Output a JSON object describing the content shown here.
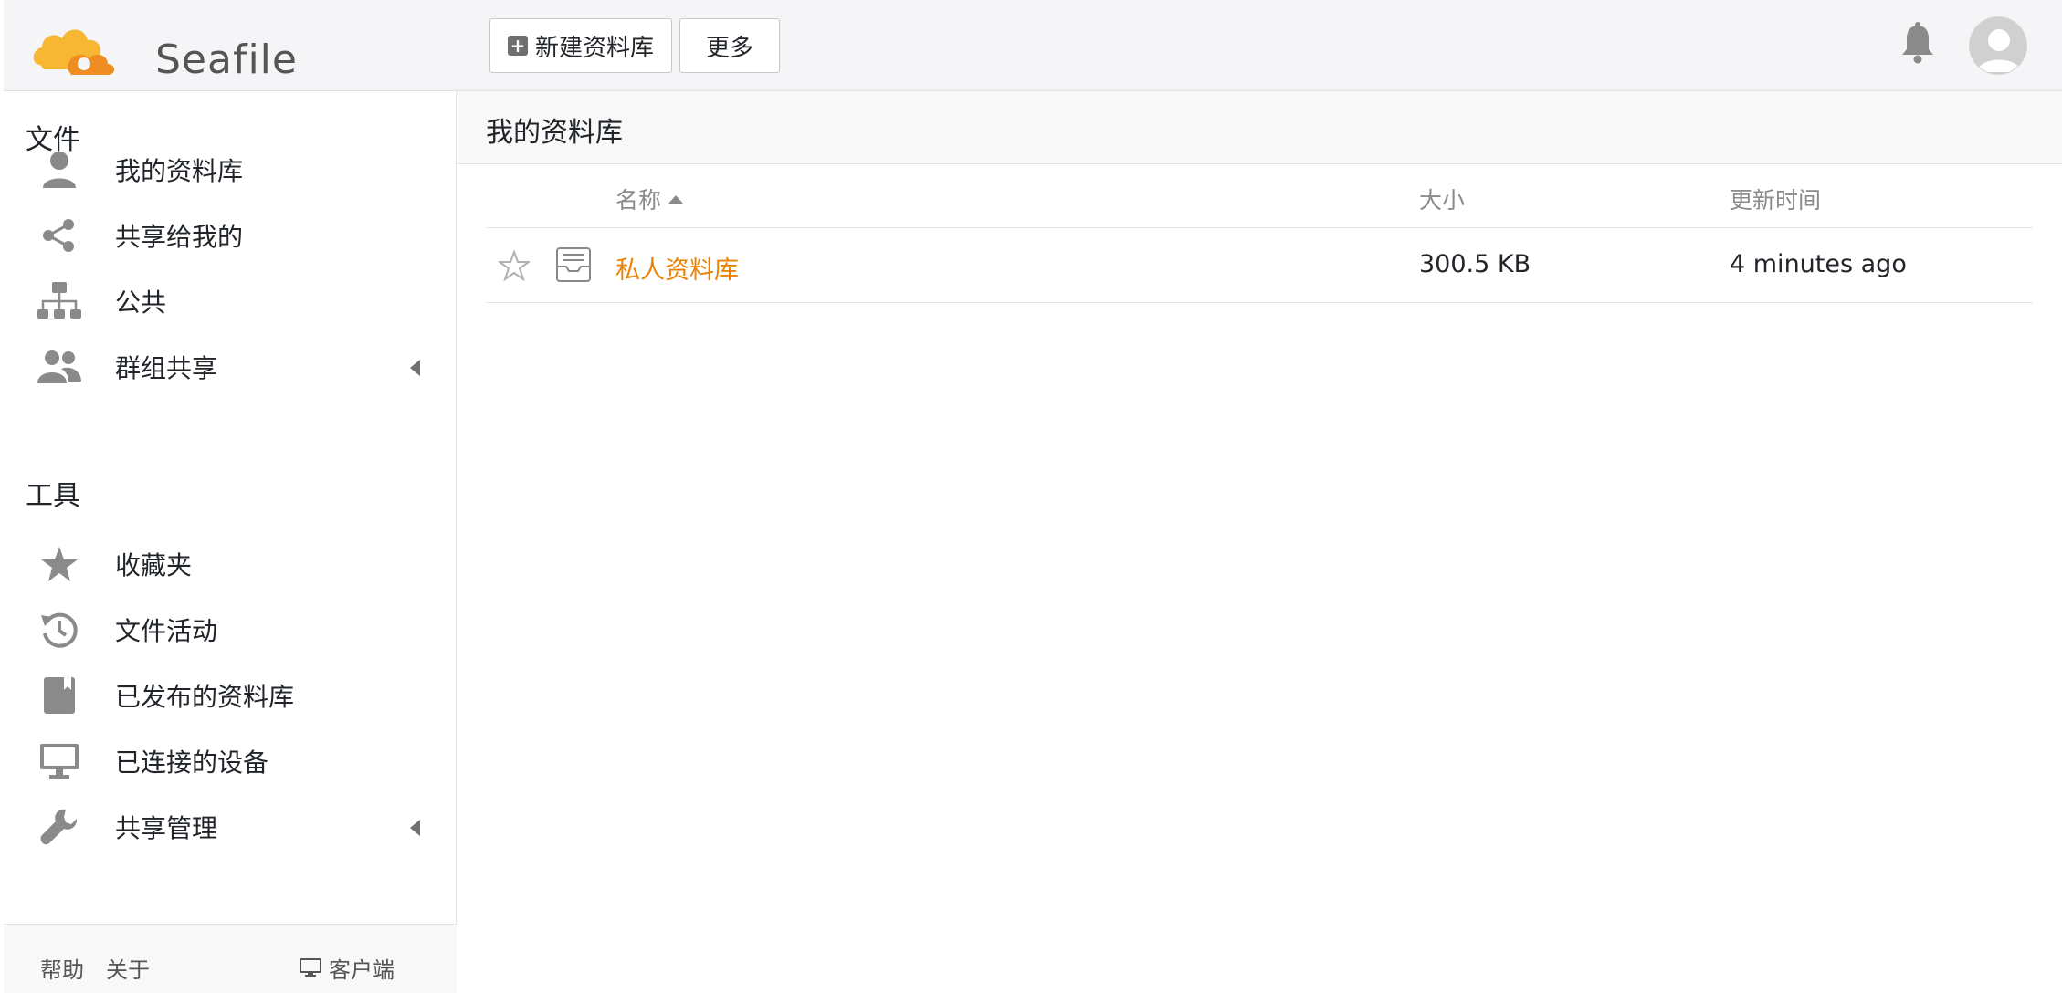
{
  "header": {
    "logo_text": "Seafile",
    "new_library_label": "新建资料库",
    "more_label": "更多"
  },
  "sidebar": {
    "files_title": "文件",
    "files_items": [
      {
        "label": "我的资料库",
        "icon": "user-icon"
      },
      {
        "label": "共享给我的",
        "icon": "share-icon"
      },
      {
        "label": "公共",
        "icon": "org-chart-icon"
      },
      {
        "label": "群组共享",
        "icon": "group-icon"
      }
    ],
    "tools_title": "工具",
    "tools_items": [
      {
        "label": "收藏夹",
        "icon": "star-icon"
      },
      {
        "label": "文件活动",
        "icon": "history-icon"
      },
      {
        "label": "已发布的资料库",
        "icon": "book-icon"
      },
      {
        "label": "已连接的设备",
        "icon": "monitor-icon"
      },
      {
        "label": "共享管理",
        "icon": "wrench-icon"
      }
    ],
    "footer": {
      "help": "帮助",
      "about": "关于",
      "client": "客户端"
    }
  },
  "main": {
    "title": "我的资料库",
    "columns": {
      "name": "名称",
      "size": "大小",
      "updated": "更新时间"
    },
    "rows": [
      {
        "name": "私人资料库",
        "size": "300.5 KB",
        "updated": "4 minutes ago"
      }
    ]
  },
  "colors": {
    "accent": "#eb8205",
    "logo_orange": "#f5a623"
  }
}
